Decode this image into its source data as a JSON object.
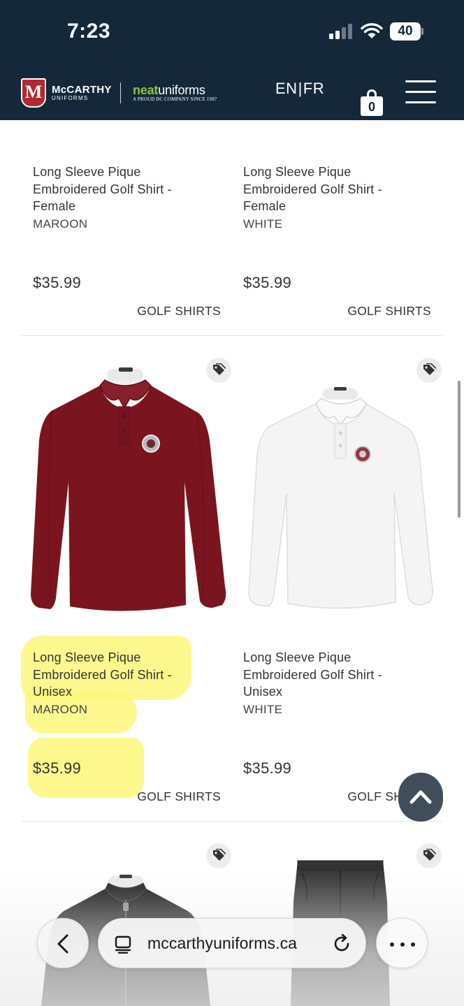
{
  "status_bar": {
    "time": "7:23",
    "battery": "40"
  },
  "header": {
    "logo_letter": "M",
    "logo_mccarthy": "McCARTHY",
    "logo_mccarthy_sub": "UNIFORMS",
    "logo_neat_bold": "neat",
    "logo_neat_rest": "uniforms",
    "logo_neat_sub": "A PROUD BC COMPANY SINCE 1987",
    "lang_en": "EN",
    "lang_sep": "|",
    "lang_fr": "FR",
    "cart_count": "0"
  },
  "products": [
    {
      "title": "Long Sleeve Pique Embroidered Golf Shirt - Female",
      "color": "MAROON",
      "price": "$35.99",
      "category": "GOLF SHIRTS"
    },
    {
      "title": "Long Sleeve Pique Embroidered Golf Shirt - Female",
      "color": "WHITE",
      "price": "$35.99",
      "category": "GOLF SHIRTS"
    },
    {
      "title": "Long Sleeve Pique Embroidered Golf Shirt - Unisex",
      "color": "MAROON",
      "price": "$35.99",
      "category": "GOLF SHIRTS",
      "shirt_color": "#7a1520"
    },
    {
      "title": "Long Sleeve Pique Embroidered Golf Shirt - Unisex",
      "color": "WHITE",
      "price": "$35.99",
      "category": "GOLF SHIRTS",
      "shirt_color": "#f2f2f2"
    }
  ],
  "browser": {
    "url": "mccarthyuniforms.ca"
  },
  "colors": {
    "header_bg": "#14283a",
    "brand_red": "#b02a2f",
    "neat_green": "#8cc63f",
    "highlight": "#fbf77a"
  }
}
